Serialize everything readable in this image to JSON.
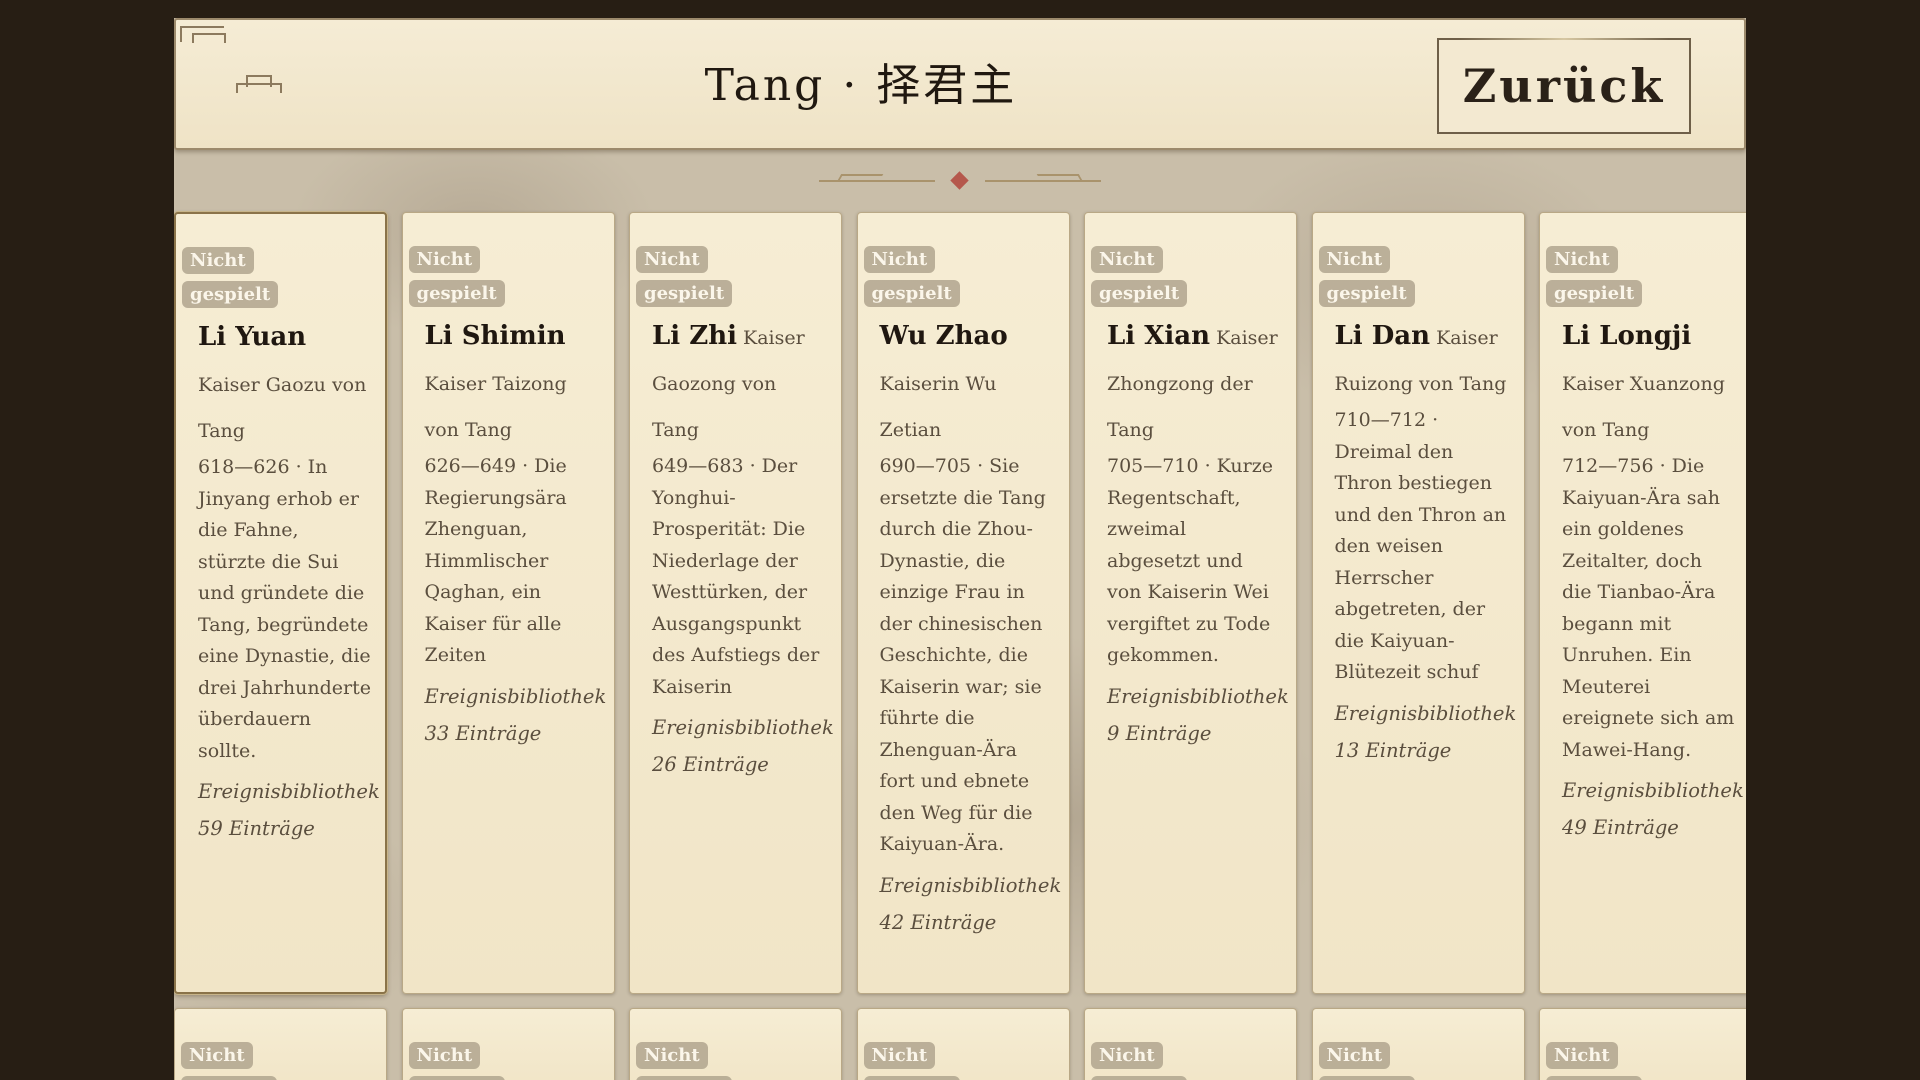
{
  "header": {
    "title": "Tang · 择君主",
    "back_label": "Zurück"
  },
  "badge_text": "Nicht gespielt",
  "emperors": [
    {
      "name": "Li Yuan",
      "title": "Kaiser Gaozu von Tang",
      "description": "618—626 · In Jinyang erhob er die Fahne, stürzte die Sui und gründete die Tang, begründete eine Dynastie, die drei Jahrhunderte überdauern sollte.",
      "library": "Ereignisbibliothek 59 Einträge",
      "selected": true
    },
    {
      "name": "Li Shimin",
      "title": "Kaiser Taizong von Tang",
      "description": "626—649 · Die Regierungsära Zhenguan, Himmlischer Qaghan, ein Kaiser für alle Zeiten",
      "library": "Ereignisbibliothek 33 Einträge",
      "selected": false
    },
    {
      "name": "Li Zhi",
      "title": "Kaiser Gaozong von Tang",
      "description": "649—683 · Der Yonghui-Prosperität: Die Niederlage der Westtürken, der Ausgangspunkt des Aufstiegs der Kaiserin",
      "library": "Ereignisbibliothek 26 Einträge",
      "selected": false
    },
    {
      "name": "Wu Zhao",
      "title": "Kaiserin Wu Zetian",
      "description": "690—705 · Sie ersetzte die Tang durch die Zhou-Dynastie, die einzige Frau in der chinesischen Geschichte, die Kaiserin war; sie führte die Zhenguan-Ära fort und ebnete den Weg für die Kaiyuan-Ära.",
      "library": "Ereignisbibliothek 42 Einträge",
      "selected": false
    },
    {
      "name": "Li Xian",
      "title": "Kaiser Zhongzong der Tang",
      "description": "705—710 · Kurze Regentschaft, zweimal abgesetzt und von Kaiserin Wei vergiftet zu Tode gekommen.",
      "library": "Ereignisbibliothek 9 Einträge",
      "selected": false
    },
    {
      "name": "Li Dan",
      "title": "Kaiser Ruizong von Tang",
      "description": "710—712 · Dreimal den Thron bestiegen und den Thron an den weisen Herrscher abgetreten, der die Kaiyuan-Blütezeit schuf",
      "library": "Ereignisbibliothek 13 Einträge",
      "selected": false
    },
    {
      "name": "Li Longji",
      "title": "Kaiser Xuanzong von Tang",
      "description": "712—756 · Die Kaiyuan-Ära sah ein goldenes Zeitalter, doch die Tianbao-Ära begann mit Unruhen. Ein Meuterei ereignete sich am Mawei-Hang.",
      "library": "Ereignisbibliothek 49 Einträge",
      "selected": false
    }
  ],
  "second_row_count": 7
}
